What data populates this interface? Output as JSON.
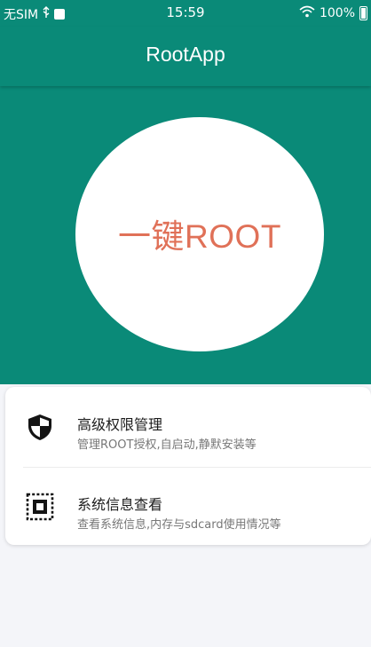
{
  "status_bar": {
    "carrier": "无SIM",
    "time": "15:59",
    "battery": "100%",
    "icons": [
      "usb-icon",
      "notification-icon",
      "wifi-icon",
      "battery-icon"
    ]
  },
  "app_bar": {
    "title": "RootApp"
  },
  "hero": {
    "root_button_label": "一键ROOT"
  },
  "menu": {
    "items": [
      {
        "title": "高级权限管理",
        "subtitle": "管理ROOT授权,自启动,静默安装等",
        "icon": "shield-icon"
      },
      {
        "title": "系统信息查看",
        "subtitle": "查看系统信息,内存与sdcard使用情况等",
        "icon": "chip-icon"
      }
    ]
  },
  "colors": {
    "primary": "#0a8a78",
    "accent": "#e07158",
    "background": "#f4f5f9"
  }
}
